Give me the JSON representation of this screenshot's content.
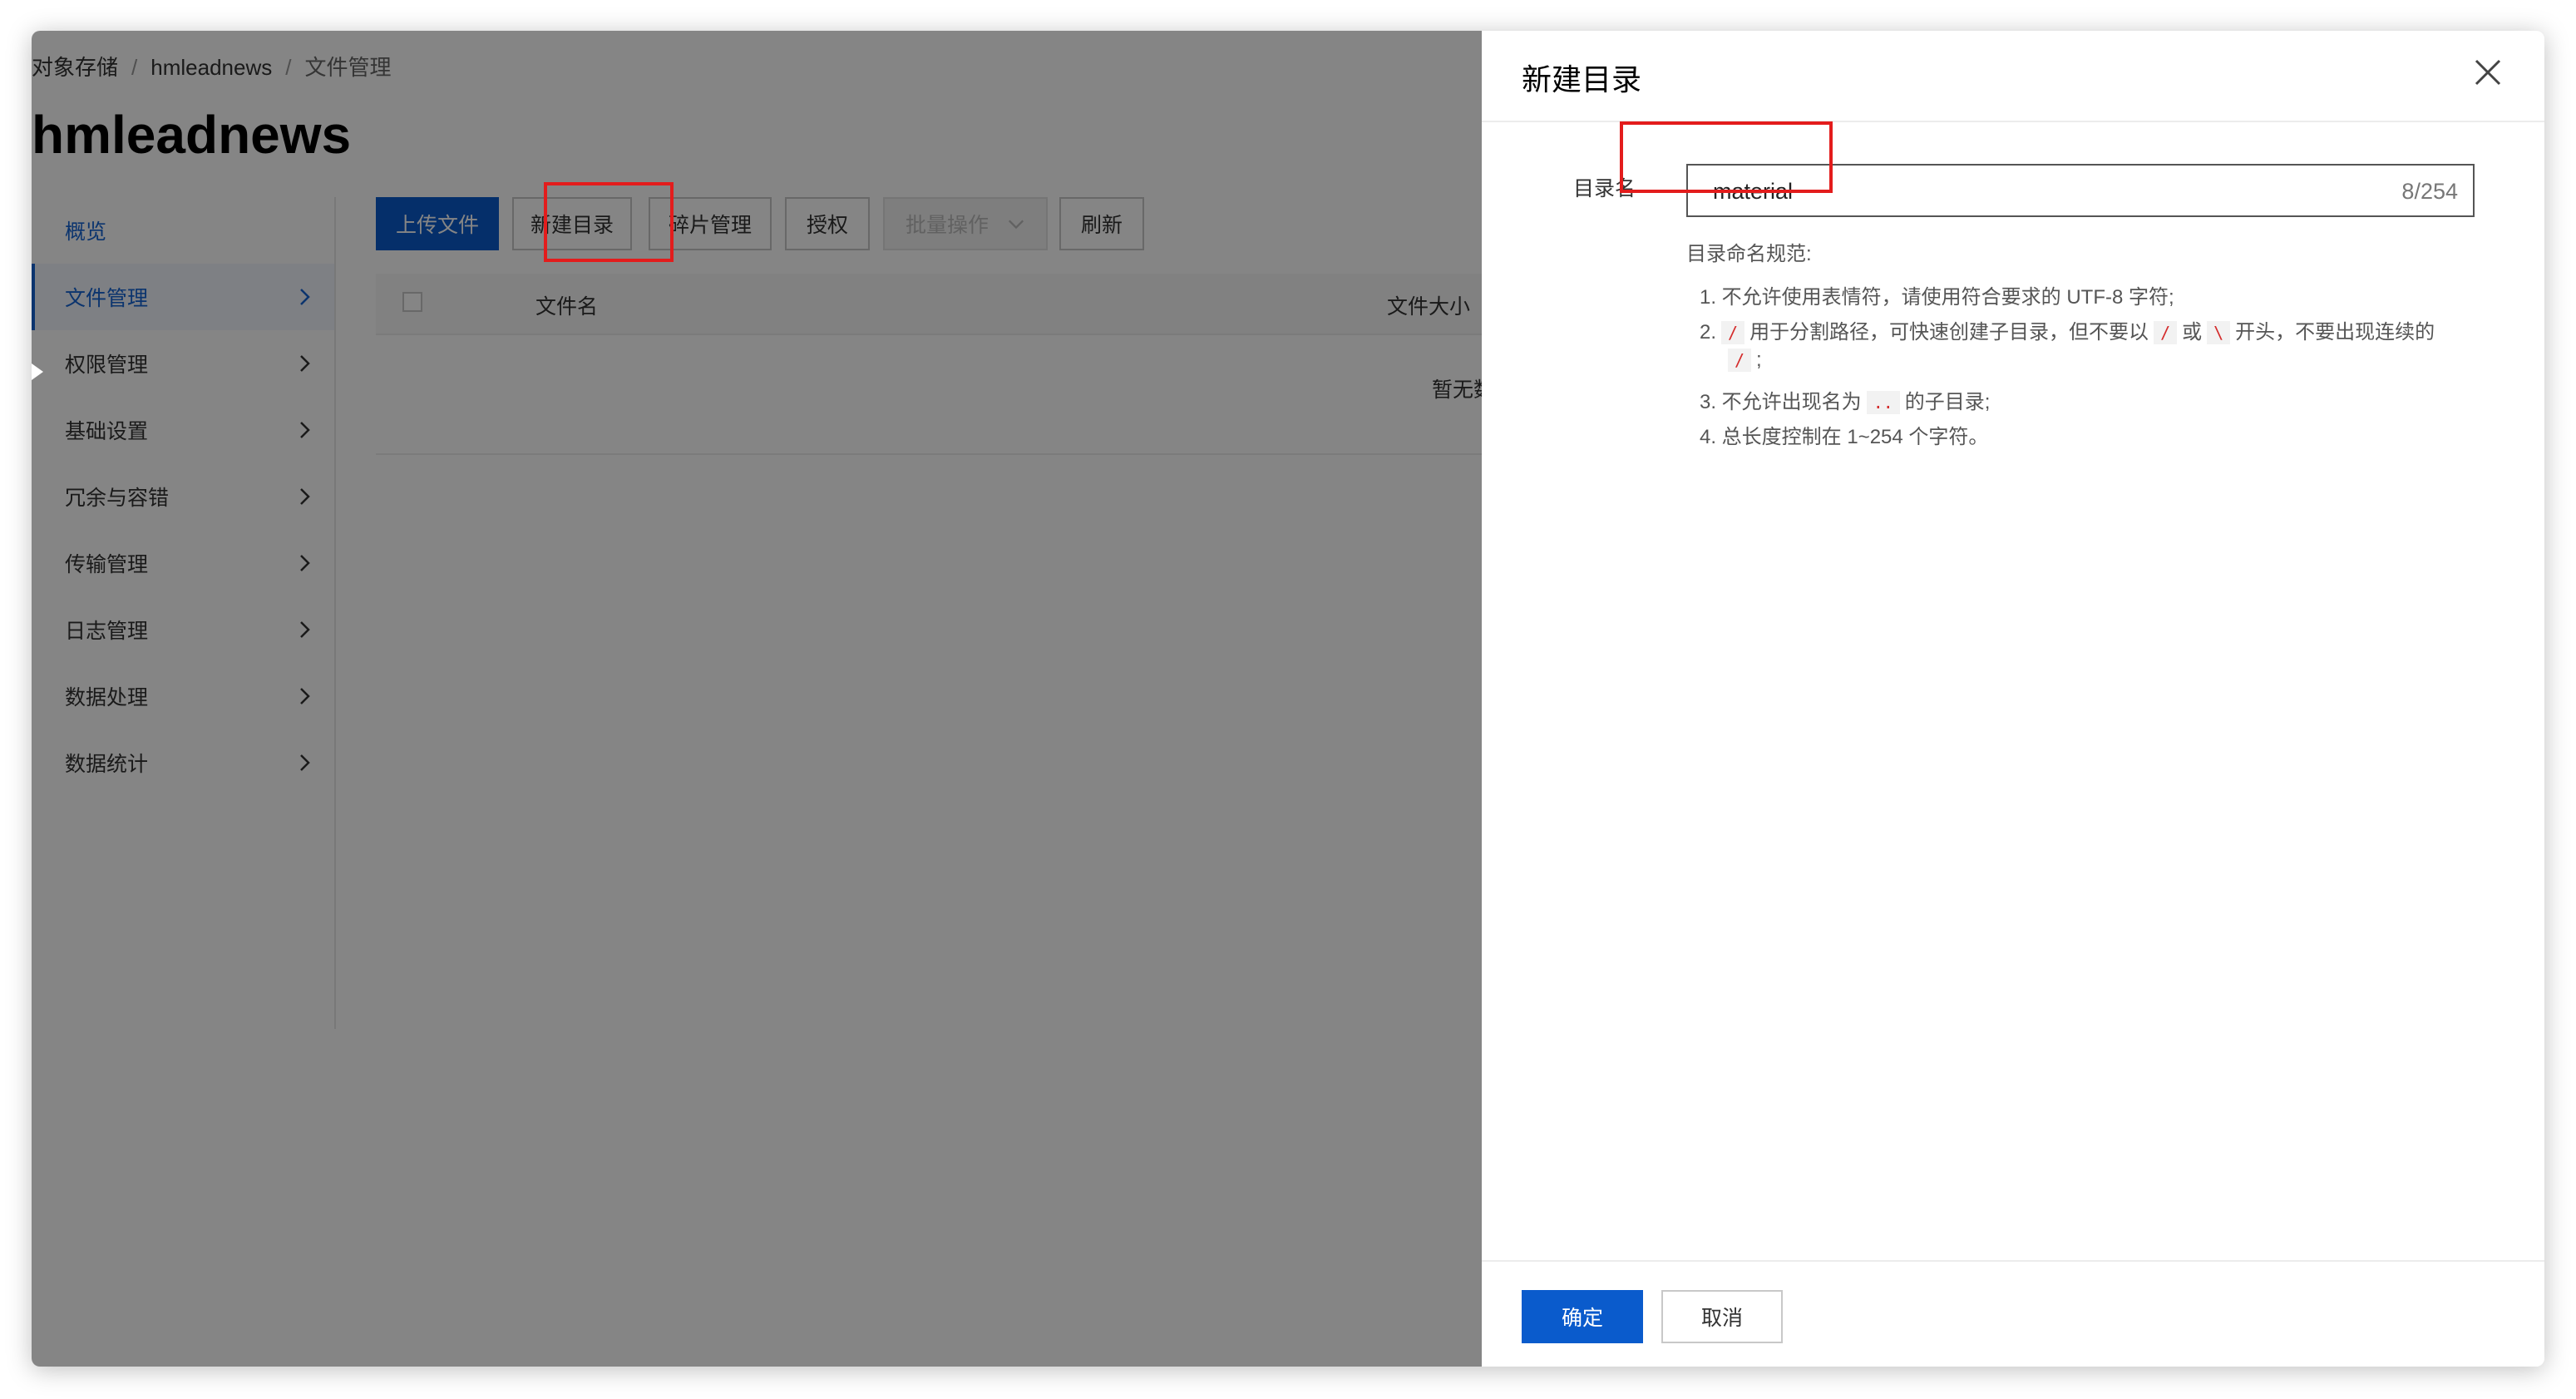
{
  "breadcrumb": {
    "root": "对象存储",
    "bucket": "hmleadnews",
    "current": "文件管理",
    "separator": "/"
  },
  "page_title": "hmleadnews",
  "sidebar": {
    "items": [
      {
        "label": "概览",
        "icon": ""
      },
      {
        "label": "文件管理",
        "icon": "chevron-right-icon"
      },
      {
        "label": "权限管理",
        "icon": "chevron-right-icon"
      },
      {
        "label": "基础设置",
        "icon": "chevron-right-icon"
      },
      {
        "label": "冗余与容错",
        "icon": "chevron-right-icon"
      },
      {
        "label": "传输管理",
        "icon": "chevron-right-icon"
      },
      {
        "label": "日志管理",
        "icon": "chevron-right-icon"
      },
      {
        "label": "数据处理",
        "icon": "chevron-right-icon"
      },
      {
        "label": "数据统计",
        "icon": "chevron-right-icon"
      }
    ]
  },
  "toolbar": {
    "upload": "上传文件",
    "new_folder": "新建目录",
    "fragments": "碎片管理",
    "authorize": "授权",
    "batch": "批量操作",
    "refresh": "刷新"
  },
  "table": {
    "col_name": "文件名",
    "col_size": "文件大小",
    "empty": "暂无数据"
  },
  "drawer": {
    "title": "新建目录",
    "field_label": "目录名",
    "input_value": "material",
    "char_count": "8/254",
    "rules_title": "目录命名规范:",
    "rule1": "1. 不允许使用表情符，请使用符合要求的 UTF-8 字符;",
    "rule2_prefix": "2.",
    "rule2_code1": "/",
    "rule2_mid": "用于分割路径，可快速创建子目录，但不要以",
    "rule2_code2": "/",
    "rule2_or": "或",
    "rule2_code3": "\\",
    "rule2_suffix": "开头，不要出现连续的",
    "rule2_code4": "/",
    "rule2_end": ";",
    "rule3_prefix": "3. 不允许出现名为",
    "rule3_code": "..",
    "rule3_suffix": "的子目录;",
    "rule4": "4. 总长度控制在 1~254 个字符。",
    "ok": "确定",
    "cancel": "取消"
  },
  "colors": {
    "primary": "#0a5bcc",
    "highlight": "#e31c1c",
    "active_nav": "#1664d3"
  }
}
